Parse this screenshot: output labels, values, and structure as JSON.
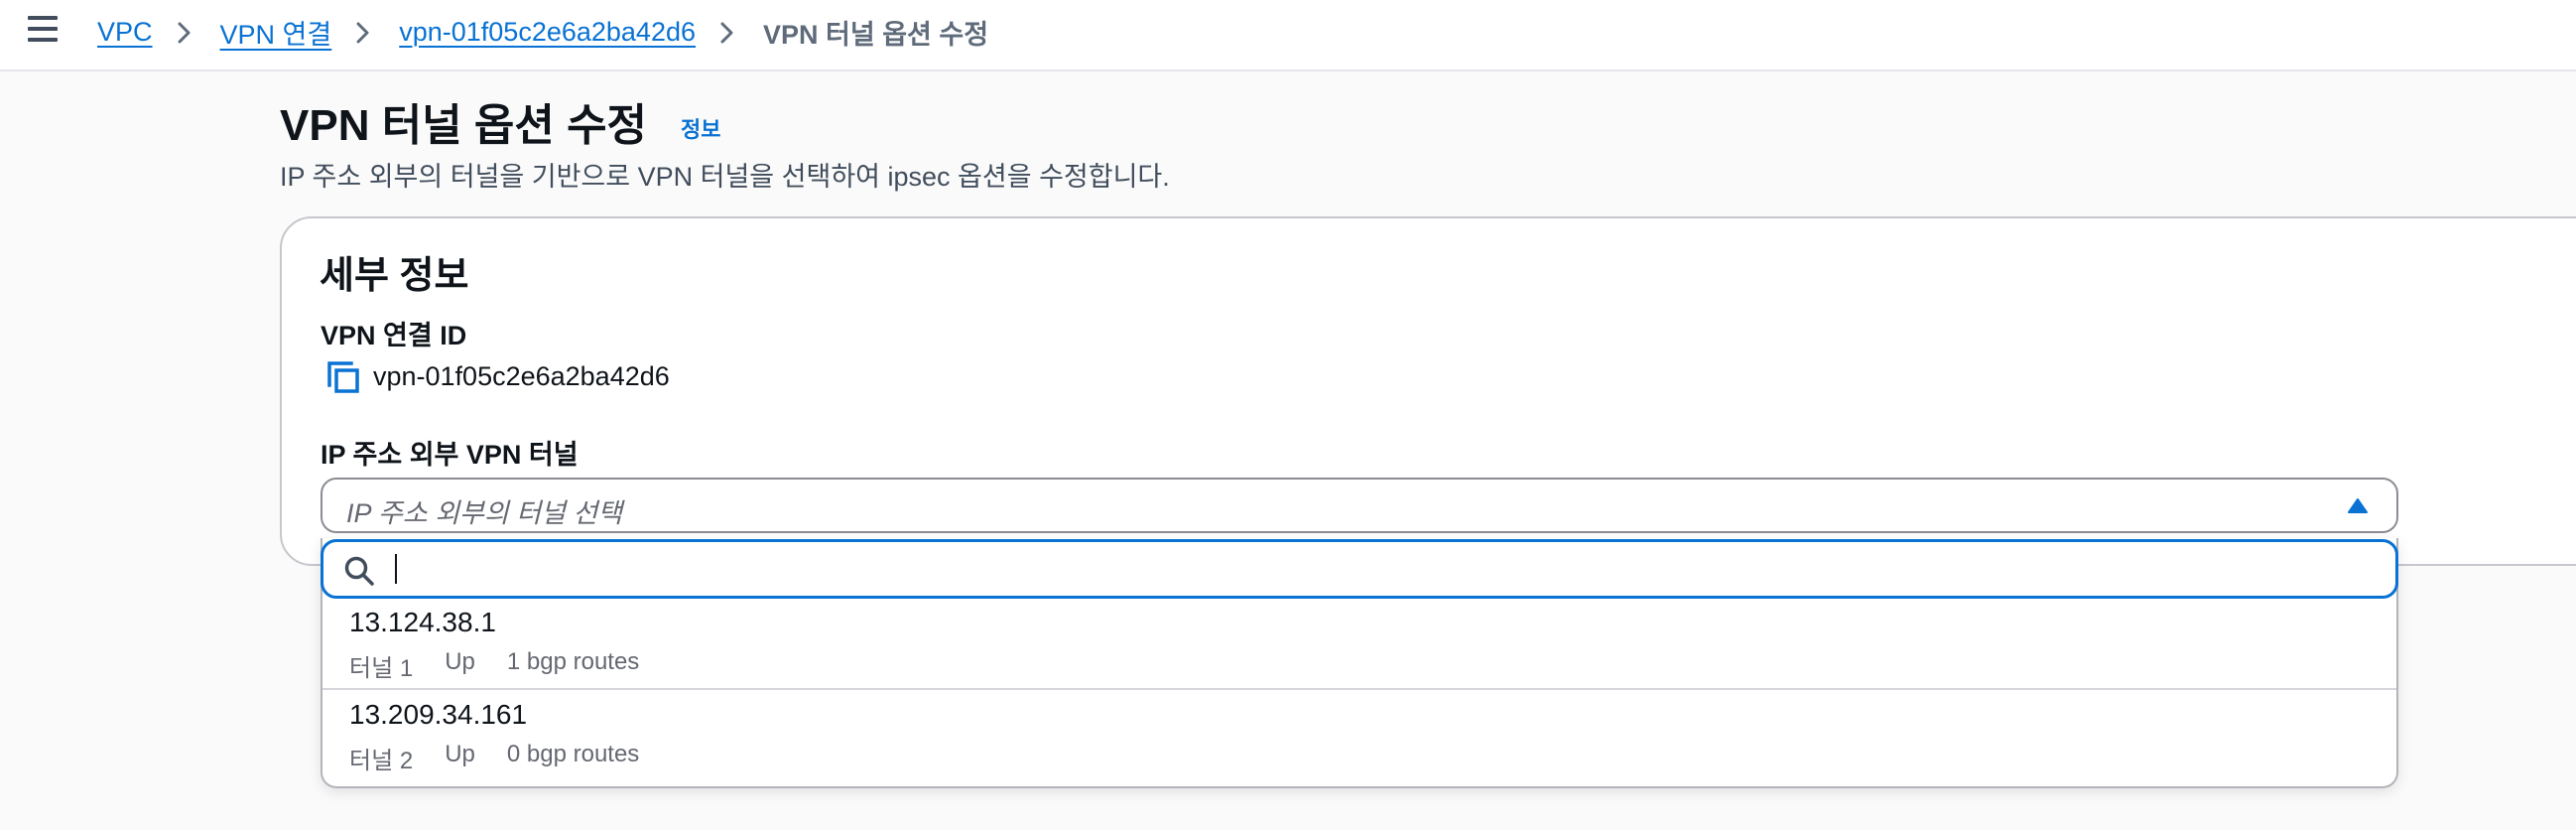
{
  "breadcrumb": {
    "items": [
      "VPC",
      "VPN 연결",
      "vpn-01f05c2e6a2ba42d6"
    ],
    "current": "VPN 터널 옵션 수정"
  },
  "header": {
    "title": "VPN 터널 옵션 수정",
    "info_link": "정보",
    "description": "IP 주소 외부의 터널을 기반으로 VPN 터널을 선택하여 ipsec 옵션을 수정합니다."
  },
  "details": {
    "section_title": "세부 정보",
    "connection_id_label": "VPN 연결 ID",
    "connection_id_value": "vpn-01f05c2e6a2ba42d6",
    "tunnel_label": "IP 주소 외부 VPN 터널",
    "tunnel_placeholder": "IP 주소 외부의 터널 선택",
    "search_value": "",
    "options": [
      {
        "label": "13.124.38.1",
        "tags": [
          "터널 1",
          "Up",
          "1 bgp routes"
        ]
      },
      {
        "label": "13.209.34.161",
        "tags": [
          "터널 2",
          "Up",
          "0 bgp routes"
        ]
      }
    ]
  },
  "colors": {
    "link": "#0972d3",
    "focus_border": "#0972d3",
    "text": "#0f141a",
    "secondary_text": "#656871"
  }
}
